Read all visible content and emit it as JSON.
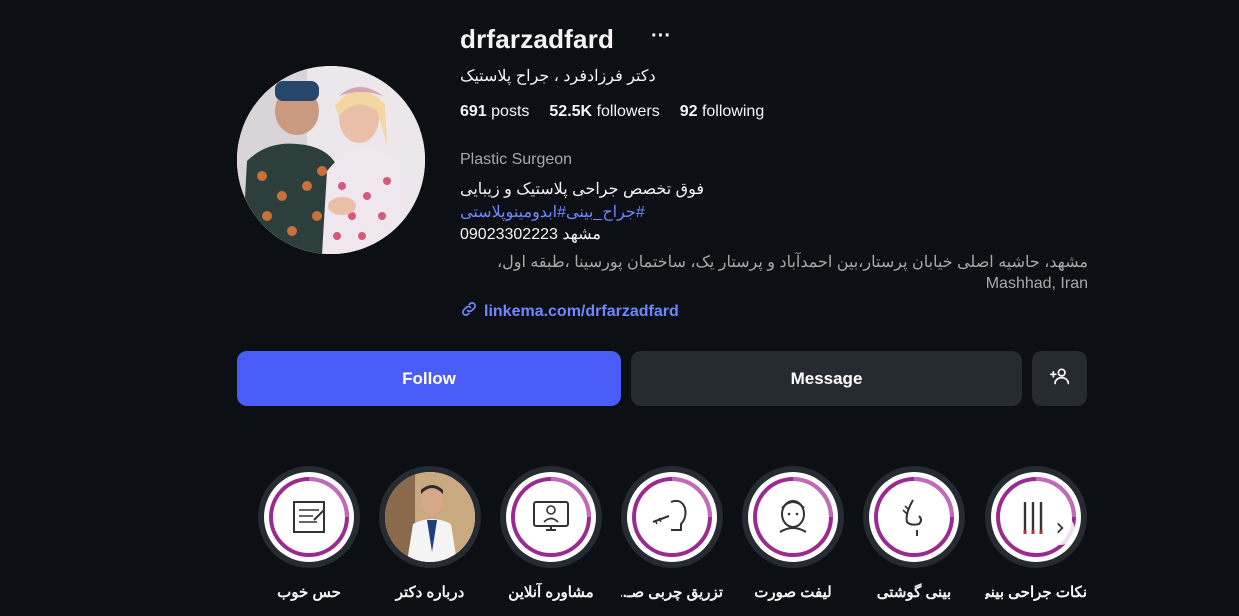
{
  "profile": {
    "username": "drfarzadfard",
    "more_label": "···",
    "full_name": "دکتر فرزادفرد ، جراح پلاستیک",
    "posts_count": "691",
    "posts_label": "posts",
    "followers_count": "52.5K",
    "followers_label": "followers",
    "following_count": "92",
    "following_label": "following",
    "category": "Plastic Surgeon",
    "bio_line1": "فوق تخصص جراحی پلاستیک و زیبایی",
    "bio_line2": "#جراح_بینی#ابدومینوپلاستی",
    "bio_line3": "مشهد 09023302223",
    "address_line1": "مشهد، حاشیه اصلی خیابان پرستار،بین احمدآباد و پرستار یک، ساختمان پورسینا ،طبقه اول،",
    "address_line2": "Mashhad, Iran",
    "link": "linkema.com/drfarzadfard"
  },
  "actions": {
    "follow_label": "Follow",
    "message_label": "Message",
    "add_user_icon": "person-add-icon"
  },
  "highlights": [
    {
      "label": "حس خوب",
      "icon": "certificate-icon"
    },
    {
      "label": "درباره دکتر",
      "icon": "doctor-photo"
    },
    {
      "label": "مشاوره آنلاین",
      "icon": "online-consult-icon"
    },
    {
      "label": "تزریق چربی صـ...",
      "icon": "fat-injection-icon"
    },
    {
      "label": "لیفت صورت",
      "icon": "face-lift-icon"
    },
    {
      "label": "بینی گوشتی",
      "icon": "nose-icon"
    },
    {
      "label": "نکات جراحی بینی",
      "icon": "surgery-tools-icon"
    }
  ],
  "colors": {
    "background": "#0c0f14",
    "accent": "#4a5df9",
    "link": "#6f88ff",
    "button": "#262a31",
    "highlight_ring": "#9b2a8f"
  }
}
